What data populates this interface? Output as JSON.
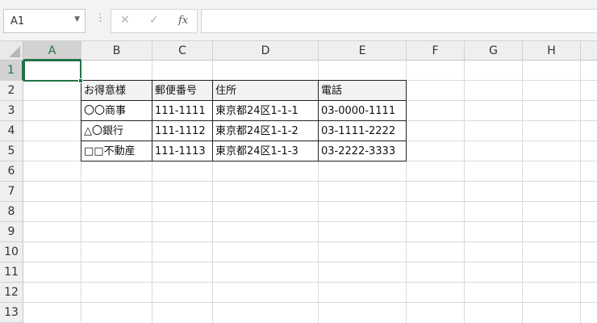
{
  "formula_bar": {
    "name_box": "A1",
    "name_box_dropdown_icon": "chevron-down-icon",
    "grip": "⋮",
    "cancel_symbol": "✕",
    "enter_symbol": "✓",
    "fx_symbol": "fx",
    "formula_value": ""
  },
  "columns": [
    "A",
    "B",
    "C",
    "D",
    "E",
    "F",
    "G",
    "H"
  ],
  "rows": [
    "1",
    "2",
    "3",
    "4",
    "5",
    "6",
    "7",
    "8",
    "9",
    "10",
    "11",
    "12",
    "13"
  ],
  "selected_cell": "A1",
  "table": {
    "headers": [
      "お得意様",
      "郵便番号",
      "住所",
      "電話"
    ],
    "rows": [
      [
        "〇〇商事",
        "111-1111",
        "東京都24区1-1-1",
        "03-0000-1111"
      ],
      [
        "△〇銀行",
        "111-1112",
        "東京都24区1-1-2",
        "03-1111-2222"
      ],
      [
        "□□不動産",
        "111-1113",
        "東京都24区1-1-3",
        "03-2222-3333"
      ]
    ]
  },
  "colors": {
    "accent": "#217346",
    "header_fill": "#f2f2f2"
  }
}
